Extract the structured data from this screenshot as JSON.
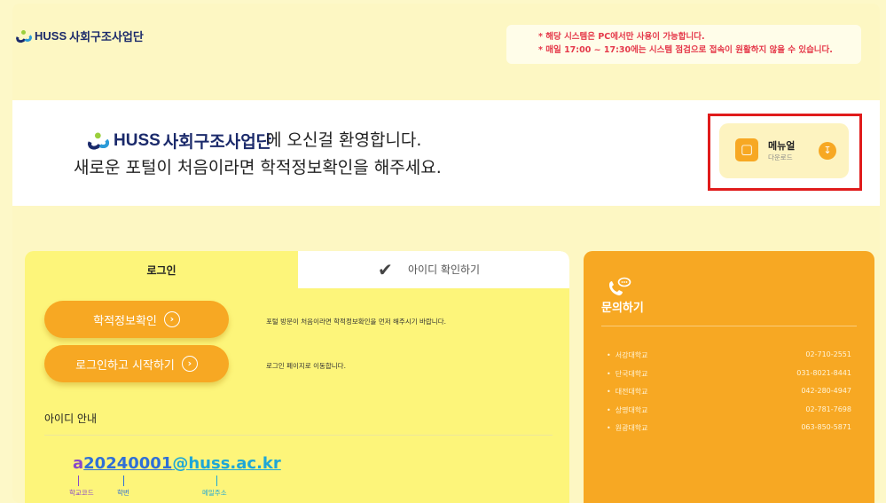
{
  "header": {
    "logo_en": "HUSS",
    "logo_ko": "사회구조사업단",
    "notices": [
      "* 해당 시스템은 PC에서만 사용이 가능합니다.",
      "* 매일 17:00 ~ 17:30에는 시스템 점검으로 접속이 원활하지 않을 수 있습니다."
    ]
  },
  "welcome": {
    "logo_en": "HUSS",
    "logo_ko": "사회구조사업단",
    "line1": "에 오신걸 환영합니다.",
    "line2": "새로운 포털이 처음이라면 학적정보확인을 해주세요.",
    "manual": {
      "title": "메뉴얼",
      "subtitle": "다운로드"
    }
  },
  "login": {
    "tabs": {
      "login": "로그인",
      "id_check": "아이디 확인하기"
    },
    "buttons": {
      "verify": "학적정보확인",
      "start": "로그인하고 시작하기"
    },
    "descriptions": {
      "verify": "포털 방문이 처음이라면 학적정보확인을 먼저 해주시기 바랍니다.",
      "start": "로그인 페이지로 이동합니다."
    },
    "id_guide": {
      "title": "아이디 안내",
      "example_code": "a",
      "example_number": "20240001",
      "example_domain": "@huss.ac.kr",
      "label_code": "학교코드",
      "label_number": "학번",
      "label_email": "메일주소"
    }
  },
  "contact": {
    "title": "문의하기",
    "items": [
      {
        "name": "서강대학교",
        "phone": "02-710-2551"
      },
      {
        "name": "단국대학교",
        "phone": "031-8021-8441"
      },
      {
        "name": "대전대학교",
        "phone": "042-280-4947"
      },
      {
        "name": "상명대학교",
        "phone": "02-781-7698"
      },
      {
        "name": "원광대학교",
        "phone": "063-850-5871"
      }
    ]
  },
  "colors": {
    "background": "#fdf7c3",
    "accent": "#f7a823",
    "notice": "#e5394a",
    "highlight_frame": "#e01b1b"
  }
}
